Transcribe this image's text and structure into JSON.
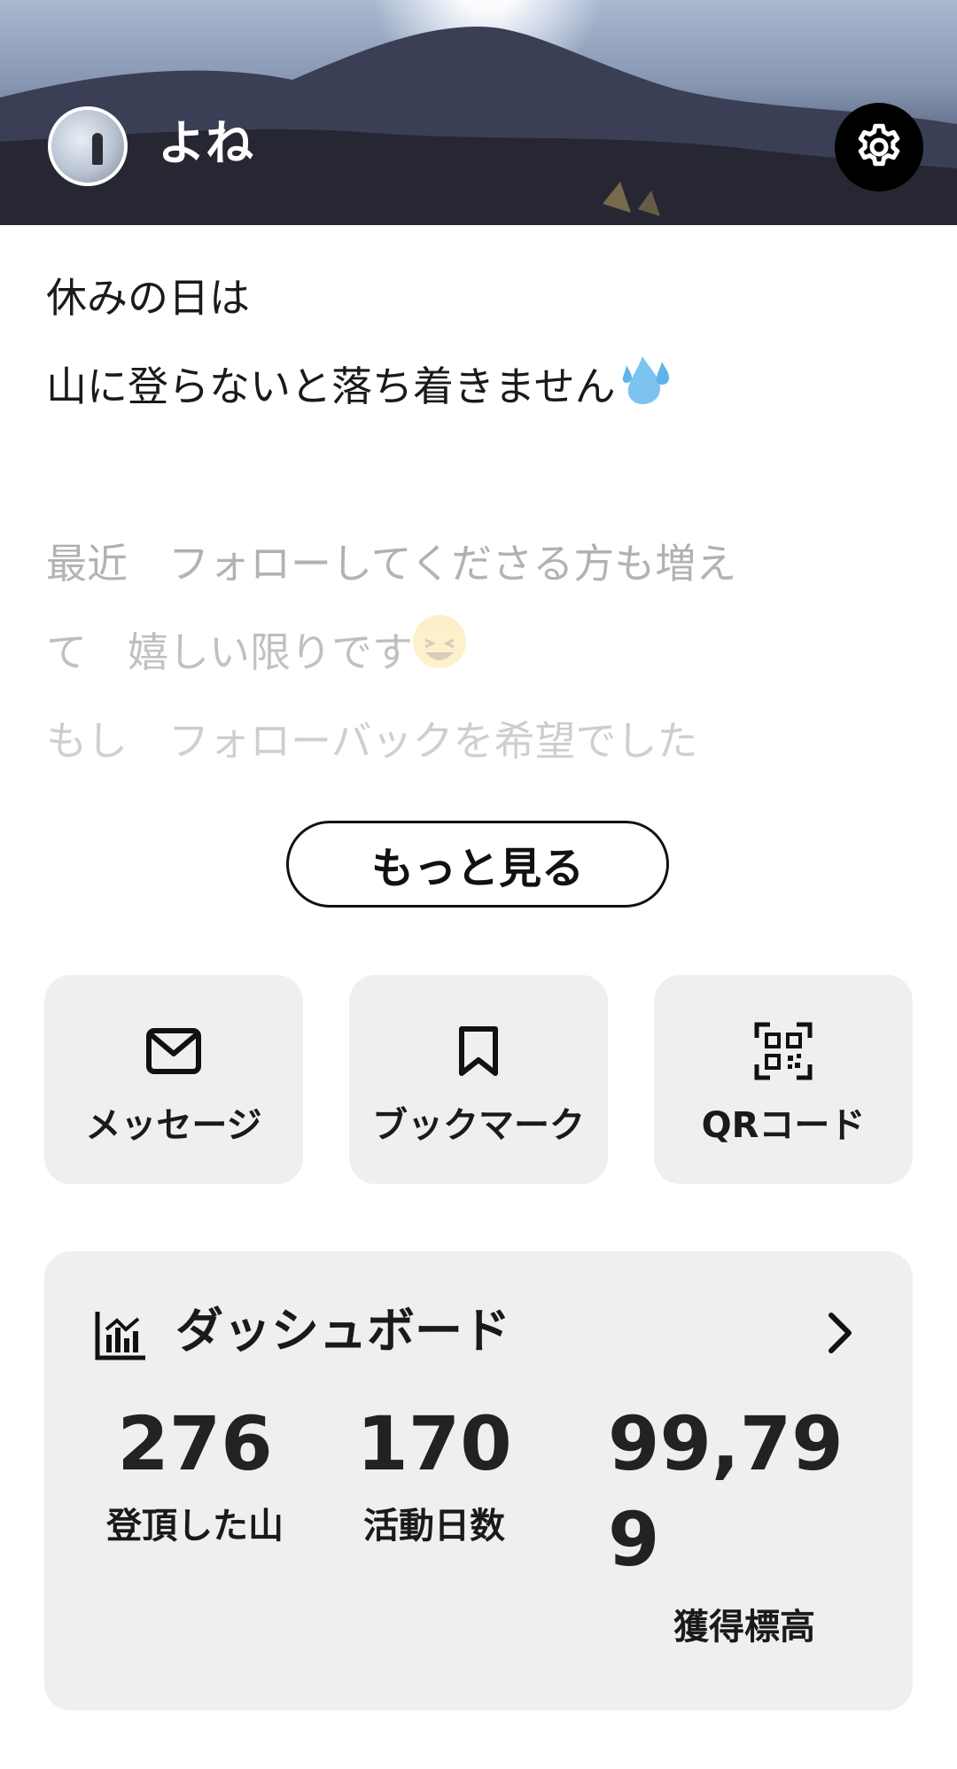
{
  "profile": {
    "username": "よね"
  },
  "bio": {
    "lines": [
      "休みの日は",
      "山に登らないと落ち着きません",
      "",
      "最近　フォローしてくださる方も増え",
      "て　嬉しい限りです",
      "もし　フォローバックを希望でした"
    ]
  },
  "more_button": {
    "label": "もっと見る"
  },
  "actions": {
    "items": [
      {
        "label": "メッセージ",
        "icon": "mail-icon"
      },
      {
        "label": "ブックマーク",
        "icon": "bookmark-icon"
      },
      {
        "label": "QRコード",
        "icon": "qr-code-icon"
      }
    ]
  },
  "dashboard": {
    "title": "ダッシュボード",
    "stats": [
      {
        "value": "276",
        "label": "登頂した山"
      },
      {
        "value": "170",
        "label": "活動日数"
      },
      {
        "value": "99,799",
        "value_line1": "99,79",
        "value_line2": "9",
        "label": "獲得標高"
      }
    ]
  },
  "icons": {
    "settings": "gear-icon",
    "dashboard": "bar-chart-icon",
    "chevron": "chevron-right-icon"
  },
  "colors": {
    "tile_background": "#efefef",
    "text_primary": "#1a1a1a",
    "settings_button": "#000000"
  }
}
